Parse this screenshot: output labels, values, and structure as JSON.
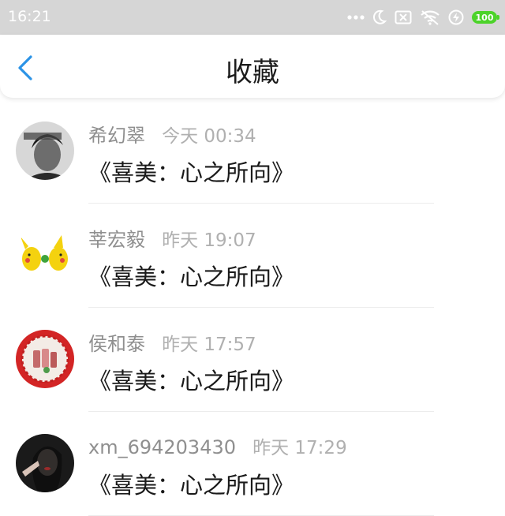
{
  "status_bar": {
    "time": "16:21",
    "battery": "100",
    "icons": [
      "more-dots-icon",
      "moon-icon",
      "no-sim-icon",
      "wifi-icon",
      "charging-icon",
      "battery-icon"
    ]
  },
  "header": {
    "title": "收藏",
    "back_icon": "chevron-left-icon"
  },
  "favorites": [
    {
      "user": "希幻翠",
      "time": "今天 00:34",
      "title": "《喜美：心之所向》",
      "avatar": "portrait-man"
    },
    {
      "user": "莘宏毅",
      "time": "昨天 19:07",
      "title": "《喜美：心之所向》",
      "avatar": "pikachu-pair"
    },
    {
      "user": "侯和泰",
      "time": "昨天 17:57",
      "title": "《喜美：心之所向》",
      "avatar": "red-plate"
    },
    {
      "user": "xm_694203430",
      "time": "昨天 17:29",
      "title": "《喜美：心之所向》",
      "avatar": "dark-portrait"
    }
  ],
  "colors": {
    "status_bar_bg": "#d6d6d6",
    "accent_blue": "#2b93e6",
    "battery_green": "#4cd32a",
    "username_gray": "#8f8f8f",
    "time_gray": "#b0b0b0"
  }
}
